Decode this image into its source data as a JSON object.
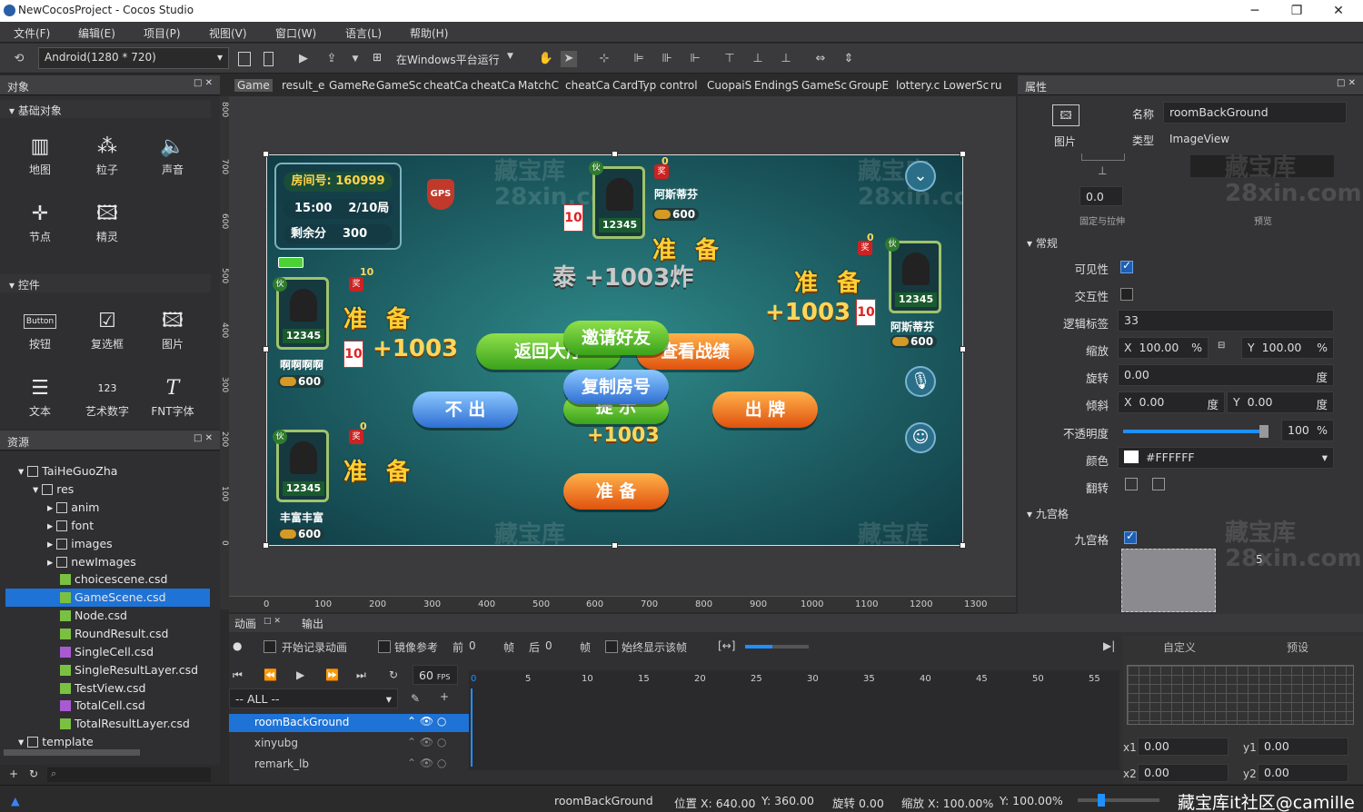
{
  "window": {
    "title": "NewCocosProject - Cocos Studio"
  },
  "menu": [
    "文件(F)",
    "编辑(E)",
    "项目(P)",
    "视图(V)",
    "窗口(W)",
    "语言(L)",
    "帮助(H)"
  ],
  "toolbar": {
    "resolution": "Android(1280 * 720)",
    "run_label": "在Windows平台运行"
  },
  "objects_panel": {
    "title": "对象",
    "basic_section": "基础对象",
    "basic_items": [
      "地图",
      "粒子",
      "声音",
      "节点",
      "精灵"
    ],
    "controls_section": "控件",
    "control_items": [
      "按钮",
      "复选框",
      "图片",
      "文本",
      "艺术数字",
      "FNT字体"
    ],
    "button_icon_text": "Button",
    "artnum_icon_text": "123"
  },
  "resources_panel": {
    "title": "资源",
    "tree": [
      "TaiHeGuoZha",
      "res",
      "anim",
      "font",
      "images",
      "newImages",
      "choicescene.csd",
      "GameScene.csd",
      "Node.csd",
      "RoundResult.csd",
      "SingleCell.csd",
      "SingleResultLayer.csd",
      "TestView.csd",
      "TotalCell.csd",
      "TotalResultLayer.csd",
      "template"
    ]
  },
  "tabs": [
    "Game",
    "result_e",
    "GameRe",
    "GameSc",
    "cheatCa",
    "cheatCa",
    "MatchC",
    "cheatCa",
    "CardTyp",
    "control",
    "CuopaiS",
    "EndingS",
    "GameSc",
    "GroupE",
    "lottery.c",
    "LowerSc",
    "ru"
  ],
  "ruler": {
    "h": [
      "0",
      "100",
      "200",
      "300",
      "400",
      "500",
      "600",
      "700",
      "800",
      "900",
      "1000",
      "1100",
      "1200",
      "1300"
    ],
    "v": [
      "800",
      "700",
      "600",
      "500",
      "400",
      "300",
      "200",
      "100",
      "0"
    ]
  },
  "scene": {
    "room_label": "房间号: 160999",
    "time": "15:00",
    "round": "2/10局",
    "remain_label": "剩余分",
    "remain": "300",
    "gps": "GPS",
    "center_text": "泰 +1003炸",
    "buttons": {
      "back": "返回大厅",
      "invite": "邀请好友",
      "view": "查看战绩",
      "copy": "复制房号",
      "hint": "提 示",
      "pass": "不 出",
      "play": "出 牌",
      "ready": "准 备"
    },
    "players": [
      {
        "id": "12345",
        "name": "阿斯蒂芬",
        "gold": "600",
        "ready": "准 备",
        "score": "+1003",
        "count": "0"
      },
      {
        "id": "12345",
        "name": "阿斯蒂芬",
        "gold": "600",
        "ready": "准 备",
        "score": "+1003",
        "count": "0"
      },
      {
        "id": "12345",
        "name": "啊啊啊啊",
        "gold": "600",
        "ready": "准 备",
        "score": "+1003",
        "count": "10"
      },
      {
        "id": "12345",
        "name": "丰富丰富",
        "gold": "600",
        "ready": "准 备",
        "score": "+1003",
        "count": "0"
      }
    ],
    "card": "10",
    "badge_friend": "伙",
    "badge_bonus": "奖",
    "badge_gold": "金币"
  },
  "watermark": {
    "cn": "藏宝库",
    "en": "28xin.com"
  },
  "properties": {
    "title": "属性",
    "kind_label": "图片",
    "name_label": "名称",
    "name_value": "roomBackGround",
    "type_label": "类型",
    "type_value": "ImageView",
    "anchor_value": "0.0",
    "anchor_caption": "固定与拉伸",
    "preview_caption": "预览",
    "general_section": "常规",
    "visible_label": "可见性",
    "interactive_label": "交互性",
    "tag_label": "逻辑标签",
    "tag_value": "33",
    "scale_label": "缩放",
    "scale_x": "100.00",
    "scale_y": "100.00",
    "pct": "%",
    "rotate_label": "旋转",
    "rotate_value": "0.00",
    "deg": "度",
    "skew_label": "倾斜",
    "skew_x": "0.00",
    "skew_y": "0.00",
    "opacity_label": "不透明度",
    "opacity_value": "100",
    "opacity": 0.95,
    "color_label": "颜色",
    "color_value": "#FFFFFF",
    "flip_label": "翻转",
    "nine_section": "九宫格",
    "nine_label": "九宫格",
    "nine_value": "5"
  },
  "animation": {
    "tab_anim": "动画",
    "tab_output": "输出",
    "record": "开始记录动画",
    "mirror": "镜像参考",
    "before": "前",
    "before_val": "0",
    "frame": "帧",
    "after": "后",
    "after_val": "0",
    "always": "始终显示该帧",
    "fps": "60",
    "fps_unit": "FPS",
    "filter": "-- ALL --",
    "ticks": [
      "0",
      "5",
      "10",
      "15",
      "20",
      "25",
      "30",
      "35",
      "40",
      "45",
      "50",
      "55"
    ],
    "nodes": [
      "roomBackGround",
      "xinyubg",
      "remark_lb"
    ],
    "custom": "自定义",
    "preset": "预设",
    "x1": "x1",
    "x1v": "0.00",
    "y1": "y1",
    "y1v": "0.00",
    "x2": "x2",
    "x2v": "0.00",
    "y2": "y2",
    "y2v": "0.00"
  },
  "status": {
    "node": "roomBackGround",
    "pos_label": "位置 X: 640.00",
    "pos_y": "Y: 360.00",
    "rot": "旋转 0.00",
    "scale": "缩放 X: 100.00%",
    "scale_y": "Y: 100.00%",
    "credit": "藏宝库it社区@camille"
  }
}
